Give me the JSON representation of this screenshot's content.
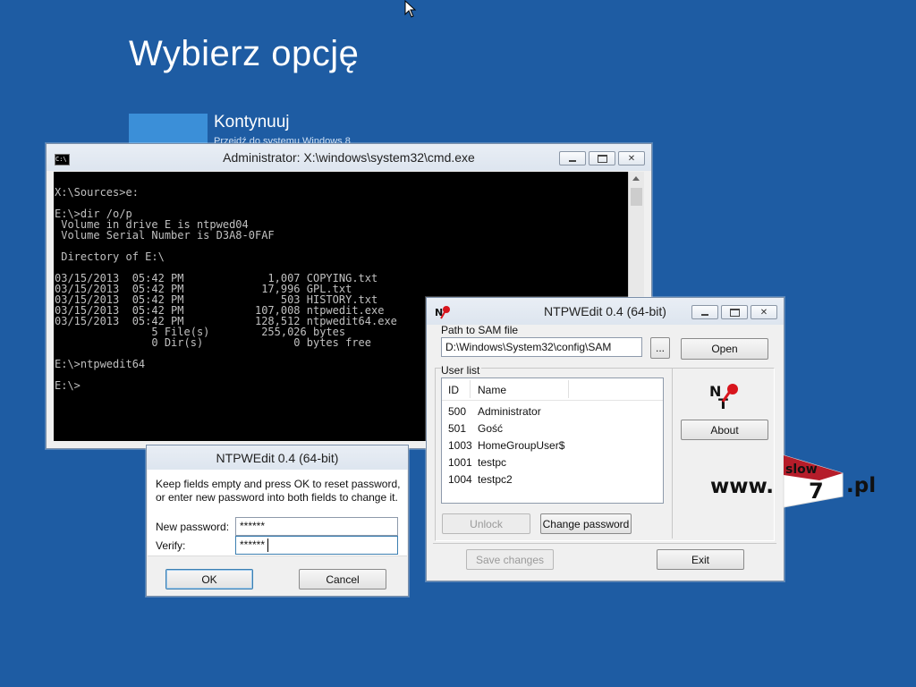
{
  "background": {
    "title": "Wybierz opcję",
    "tile": {
      "label": "Kontynuuj",
      "sublabel": "Przejdź do systemu Windows 8"
    }
  },
  "cmd_window": {
    "title": "Administrator: X:\\windows\\system32\\cmd.exe",
    "icon": "cmd-icon",
    "icon_text": "C:\\",
    "console_lines": [
      "",
      "X:\\Sources>e:",
      "",
      "E:\\>dir /o/p",
      " Volume in drive E is ntpwed04",
      " Volume Serial Number is D3A8-0FAF",
      "",
      " Directory of E:\\",
      "",
      "03/15/2013  05:42 PM             1,007 COPYING.txt",
      "03/15/2013  05:42 PM            17,996 GPL.txt",
      "03/15/2013  05:42 PM               503 HISTORY.txt",
      "03/15/2013  05:42 PM           107,008 ntpwedit.exe",
      "03/15/2013  05:42 PM           128,512 ntpwedit64.exe",
      "               5 File(s)        255,026 bytes",
      "               0 Dir(s)              0 bytes free",
      "",
      "E:\\>ntpwedit64",
      "",
      "E:\\>"
    ]
  },
  "ntpwedit": {
    "title": "NTPWEdit 0.4 (64-bit)",
    "sam_label": "Path to SAM file",
    "sam_path": "D:\\Windows\\System32\\config\\SAM",
    "browse_label": "...",
    "open_label": "Open",
    "user_list_label": "User list",
    "columns": {
      "id": "ID",
      "name": "Name"
    },
    "users": [
      {
        "id": "500",
        "name": "Administrator"
      },
      {
        "id": "501",
        "name": "Gość"
      },
      {
        "id": "1003",
        "name": "HomeGroupUser$"
      },
      {
        "id": "1001",
        "name": "testpc"
      },
      {
        "id": "1004",
        "name": "testpc2"
      }
    ],
    "logo_text": "NT",
    "about_label": "About",
    "unlock_label": "Unlock",
    "change_password_label": "Change password",
    "save_changes_label": "Save changes",
    "exit_label": "Exit"
  },
  "password_dialog": {
    "title": "NTPWEdit 0.4 (64-bit)",
    "message_line1": "Keep fields empty and press OK to reset password,",
    "message_line2": "or enter new password into both fields to change it.",
    "new_password_label": "New password:",
    "new_password_value": "******",
    "verify_label": "Verify:",
    "verify_value": "******",
    "ok_label": "OK",
    "cancel_label": "Cancel"
  },
  "watermark": {
    "prefix": "www.",
    "word": "slow",
    "number": "7",
    "suffix": ".pl"
  },
  "colors": {
    "desktop": "#1e5ca3",
    "console_bg": "#000000",
    "console_fg": "#c0c0c0",
    "window_bg": "#f0f0f0",
    "logo_red": "#d8151d"
  }
}
